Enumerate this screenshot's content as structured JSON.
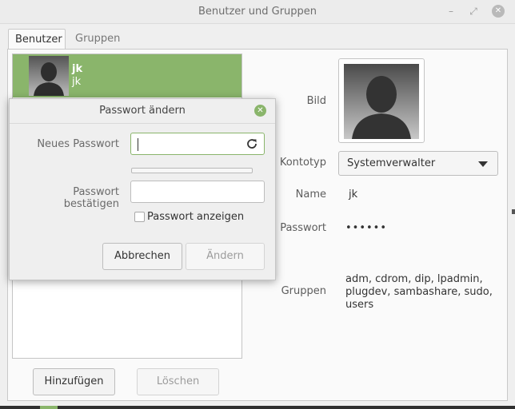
{
  "window": {
    "title": "Benutzer und Gruppen"
  },
  "tabs": [
    {
      "label": "Benutzer"
    },
    {
      "label": "Gruppen"
    }
  ],
  "user_list": [
    {
      "username": "jk",
      "realname": "jk"
    }
  ],
  "buttons": {
    "add": "Hinzufügen",
    "delete": "Löschen"
  },
  "details": {
    "picture_label": "Bild",
    "account_type_label": "Kontotyp",
    "account_type_value": "Systemverwalter",
    "name_label": "Name",
    "name_value": "jk",
    "password_label": "Passwort",
    "password_value": "••••••",
    "groups_label": "Gruppen",
    "groups_value": "adm, cdrom, dip, lpadmin, plugdev, sambashare, sudo, users"
  },
  "dialog": {
    "title": "Passwort ändern",
    "new_password_label": "Neues Passwort",
    "new_password_value": "",
    "confirm_label": "Passwort bestätigen",
    "confirm_value": "",
    "show_password_label": "Passwort anzeigen",
    "show_password_checked": false,
    "cancel_label": "Abbrechen",
    "change_label": "Ändern",
    "strength": 0
  },
  "colors": {
    "accent": "#8ab56b"
  }
}
